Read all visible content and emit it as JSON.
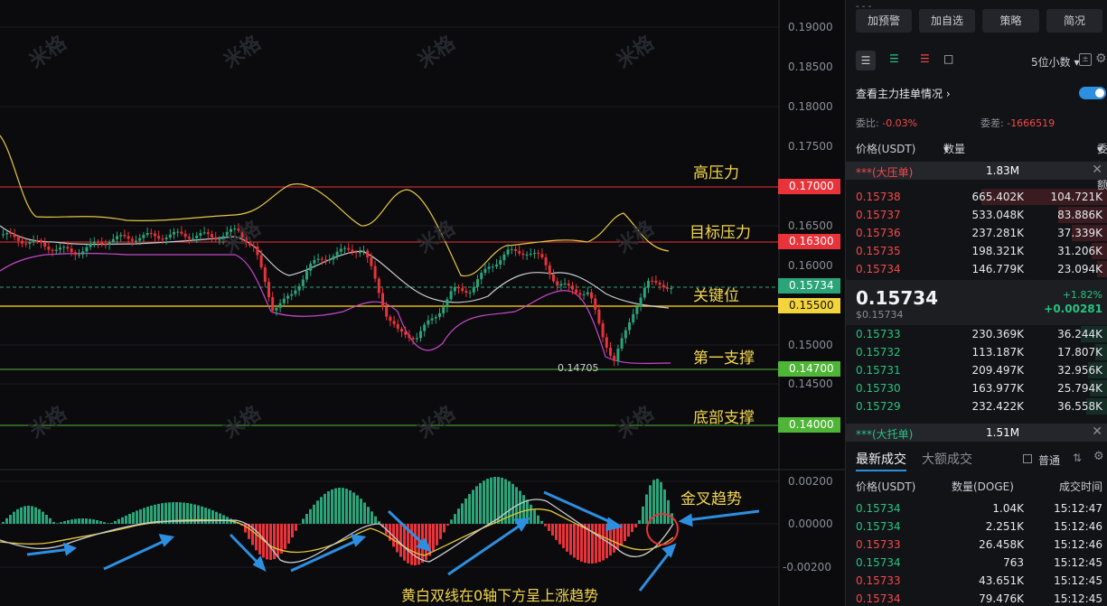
{
  "chart": {
    "price_ticks": [
      "0.19000",
      "0.18500",
      "0.18000",
      "0.17500",
      "0.16500",
      "0.16000",
      "0.15000",
      "0.14500"
    ],
    "macd_ticks": [
      "0.00200",
      "0.00000",
      "-0.00200"
    ],
    "price_tags": [
      {
        "value": "0.17000",
        "color": "#e8333a"
      },
      {
        "value": "0.16300",
        "color": "#e8333a"
      },
      {
        "value": "0.15734",
        "color": "#2aa478"
      },
      {
        "value": "0.15500",
        "color": "#e2b711"
      },
      {
        "value": "0.14700",
        "color": "#4fb537"
      },
      {
        "value": "0.14000",
        "color": "#4fb537"
      }
    ],
    "level_labels": [
      "高压力",
      "目标压力",
      "关键位",
      "第一支撑",
      "底部支撑"
    ],
    "low_marker": "0.14705",
    "macd_labels": {
      "cross": "金叉趋势",
      "trend": "黄白双线在0轴下方呈上涨趋势"
    },
    "watermark": "米格"
  },
  "side": {
    "buttons": [
      "加预警",
      "加自选",
      "策略",
      "简况"
    ],
    "decimal_select": "5位小数",
    "main_orders_label": "查看主力挂单情况",
    "wei_bi_label": "委比:",
    "wei_bi_value": "-0.03%",
    "wei_cha_label": "委差:",
    "wei_cha_value": "-1666519",
    "headers": {
      "price": "价格(USDT)",
      "qty": "数量 (DOGE)",
      "amt": "委托额"
    },
    "big_ask_label": "***(大压单)",
    "big_ask_value": "1.83M",
    "asks": [
      [
        "0.15738",
        "665.402K",
        "104.721K"
      ],
      [
        "0.15737",
        "533.048K",
        "83.886K"
      ],
      [
        "0.15736",
        "237.281K",
        "37.339K"
      ],
      [
        "0.15735",
        "198.321K",
        "31.206K"
      ],
      [
        "0.15734",
        "146.779K",
        "23.094K"
      ]
    ],
    "last_price": "0.15734",
    "last_price_usd": "$0.15734",
    "change_pct": "+1.82%",
    "change_abs": "+0.00281",
    "bids": [
      [
        "0.15733",
        "230.369K",
        "36.244K"
      ],
      [
        "0.15732",
        "113.187K",
        "17.807K"
      ],
      [
        "0.15731",
        "209.497K",
        "32.956K"
      ],
      [
        "0.15730",
        "163.977K",
        "25.794K"
      ],
      [
        "0.15729",
        "232.422K",
        "36.558K"
      ]
    ],
    "big_bid_label": "***(大托单)",
    "big_bid_value": "1.51M",
    "trade_tabs": [
      "最新成交",
      "大额成交"
    ],
    "normal_label": "普通",
    "trade_headers": {
      "price": "价格(USDT)",
      "qty": "数量(DOGE)",
      "time": "成交时间"
    },
    "trades": [
      [
        "0.15734",
        "1.04K",
        "15:12:47",
        "green"
      ],
      [
        "0.15734",
        "2.251K",
        "15:12:46",
        "green"
      ],
      [
        "0.15733",
        "26.458K",
        "15:12:46",
        "red"
      ],
      [
        "0.15734",
        "763",
        "15:12:45",
        "green"
      ],
      [
        "0.15733",
        "43.651K",
        "15:12:45",
        "red"
      ],
      [
        "0.15734",
        "79.476K",
        "15:12:45",
        "red"
      ]
    ]
  }
}
